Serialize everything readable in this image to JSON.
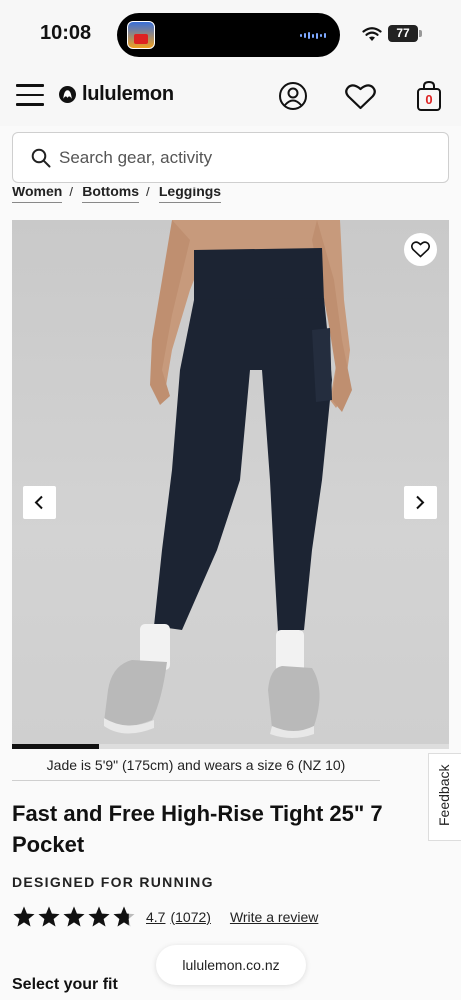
{
  "status_bar": {
    "time": "10:08",
    "battery": "77"
  },
  "header": {
    "logo_text": "lululemon",
    "bag_count": "0"
  },
  "search": {
    "placeholder": "Search gear, activity"
  },
  "breadcrumb": {
    "items": [
      "Women",
      "Bottoms",
      "Leggings"
    ],
    "separator": "/"
  },
  "gallery": {
    "current_image": 1,
    "total_images": 5,
    "progress_fraction": 0.2
  },
  "product": {
    "model_note": "Jade is 5'9\" (175cm) and wears a size 6 (NZ 10)",
    "title": "Fast and Free High-Rise Tight 25\" 7 Pocket",
    "designed_for": "DESIGNED FOR RUNNING",
    "rating": "4.7",
    "rating_stars": 4.7,
    "review_count": "(1072)",
    "write_review_label": "Write a review",
    "select_fit_label": "Select your fit"
  },
  "feedback_label": "Feedback",
  "browser": {
    "url": "lululemon.co.nz"
  },
  "colors": {
    "accent_red": "#d22222",
    "text": "#111111",
    "leggings_navy": "#1c2433"
  }
}
